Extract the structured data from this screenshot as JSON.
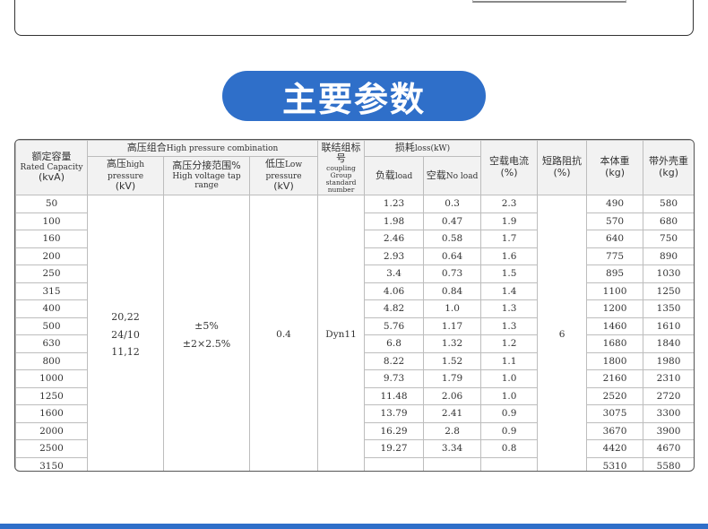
{
  "banner": "主要参数",
  "headers": {
    "rated_cn": "额定容量",
    "rated_en": "Rated Capacity",
    "rated_unit": "(kvA)",
    "hp_combo_cn": "高压组合",
    "hp_combo_en": "High pressure combination",
    "hp_cn": "高压",
    "hp_en": "high pressure",
    "hp_unit": "(kV)",
    "tap_cn": "高压分接范围%",
    "tap_en": "High voltage tap range",
    "lv_cn": "低压",
    "lv_en": "Low pressure",
    "lv_unit": "(kV)",
    "group_cn": "联结组标号",
    "group_en1": "coupling",
    "group_en2": "Group standard number",
    "loss_cn": "损耗",
    "loss_en": "loss(kW)",
    "load_cn": "负载",
    "load_en": "load",
    "noload_cn": "空载",
    "noload_en": "No load",
    "current_cn": "空载电流",
    "current_unit": "(%)",
    "imp_cn": "短路阻抗",
    "imp_unit": "(%)",
    "body_cn": "本体重",
    "body_unit": "(kg)",
    "shell_cn": "带外壳重",
    "shell_unit": "(kg)"
  },
  "merged": {
    "hp_values": [
      "20,22",
      "24/10",
      "11,12"
    ],
    "tap_values": [
      "±5%",
      "±2×2.5%"
    ],
    "lv": "0.4",
    "group": "Dyn11",
    "impedance": "6"
  },
  "rows": [
    {
      "cap": "50",
      "load": "1.23",
      "noload": "0.3",
      "current": "2.3",
      "body": "490",
      "shell": "580"
    },
    {
      "cap": "100",
      "load": "1.98",
      "noload": "0.47",
      "current": "1.9",
      "body": "570",
      "shell": "680"
    },
    {
      "cap": "160",
      "load": "2.46",
      "noload": "0.58",
      "current": "1.7",
      "body": "640",
      "shell": "750"
    },
    {
      "cap": "200",
      "load": "2.93",
      "noload": "0.64",
      "current": "1.6",
      "body": "775",
      "shell": "890"
    },
    {
      "cap": "250",
      "load": "3.4",
      "noload": "0.73",
      "current": "1.5",
      "body": "895",
      "shell": "1030"
    },
    {
      "cap": "315",
      "load": "4.06",
      "noload": "0.84",
      "current": "1.4",
      "body": "1100",
      "shell": "1250"
    },
    {
      "cap": "400",
      "load": "4.82",
      "noload": "1.0",
      "current": "1.3",
      "body": "1200",
      "shell": "1350"
    },
    {
      "cap": "500",
      "load": "5.76",
      "noload": "1.17",
      "current": "1.3",
      "body": "1460",
      "shell": "1610"
    },
    {
      "cap": "630",
      "load": "6.8",
      "noload": "1.32",
      "current": "1.2",
      "body": "1680",
      "shell": "1840"
    },
    {
      "cap": "800",
      "load": "8.22",
      "noload": "1.52",
      "current": "1.1",
      "body": "1800",
      "shell": "1980"
    },
    {
      "cap": "1000",
      "load": "9.73",
      "noload": "1.79",
      "current": "1.0",
      "body": "2160",
      "shell": "2310"
    },
    {
      "cap": "1250",
      "load": "11.48",
      "noload": "2.06",
      "current": "1.0",
      "body": "2520",
      "shell": "2720"
    },
    {
      "cap": "1600",
      "load": "13.79",
      "noload": "2.41",
      "current": "0.9",
      "body": "3075",
      "shell": "3300"
    },
    {
      "cap": "2000",
      "load": "16.29",
      "noload": "2.8",
      "current": "0.9",
      "body": "3670",
      "shell": "3900"
    },
    {
      "cap": "2500",
      "load": "19.27",
      "noload": "3.34",
      "current": "0.8",
      "body": "4420",
      "shell": "4670"
    },
    {
      "cap": "3150",
      "load": "",
      "noload": "",
      "current": "",
      "body": "5310",
      "shell": "5580"
    }
  ]
}
